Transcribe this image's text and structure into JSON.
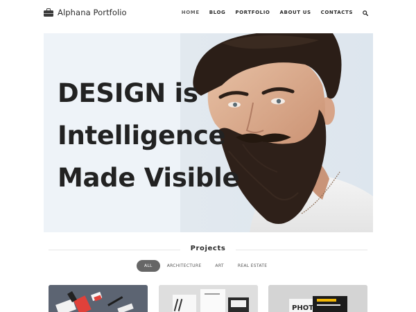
{
  "header": {
    "logo_text": "Alphana Portfolio",
    "nav": [
      {
        "label": "HOME",
        "active": true
      },
      {
        "label": "BLOG",
        "active": false
      },
      {
        "label": "PORTFOLIO",
        "active": false
      },
      {
        "label": "ABOUT US",
        "active": false
      },
      {
        "label": "CONTACTS",
        "active": false
      }
    ]
  },
  "hero": {
    "title_lines": [
      "DESIGN is",
      "Intelligence",
      "Made Visible"
    ]
  },
  "projects": {
    "title": "Projects",
    "filters": [
      {
        "label": "ALL",
        "active": true
      },
      {
        "label": "ARCHITECTURE",
        "active": false
      },
      {
        "label": "ART",
        "active": false
      },
      {
        "label": "REAL ESTATE",
        "active": false
      }
    ],
    "cards": [
      {
        "name": "stationery-mockup"
      },
      {
        "name": "business-card-mockup"
      },
      {
        "name": "photo-book-mockup",
        "visible_text": "PHOTO"
      }
    ]
  },
  "colors": {
    "hero_bg": "#eef3f8",
    "text_dark": "#222222",
    "filter_active": "#666666"
  }
}
